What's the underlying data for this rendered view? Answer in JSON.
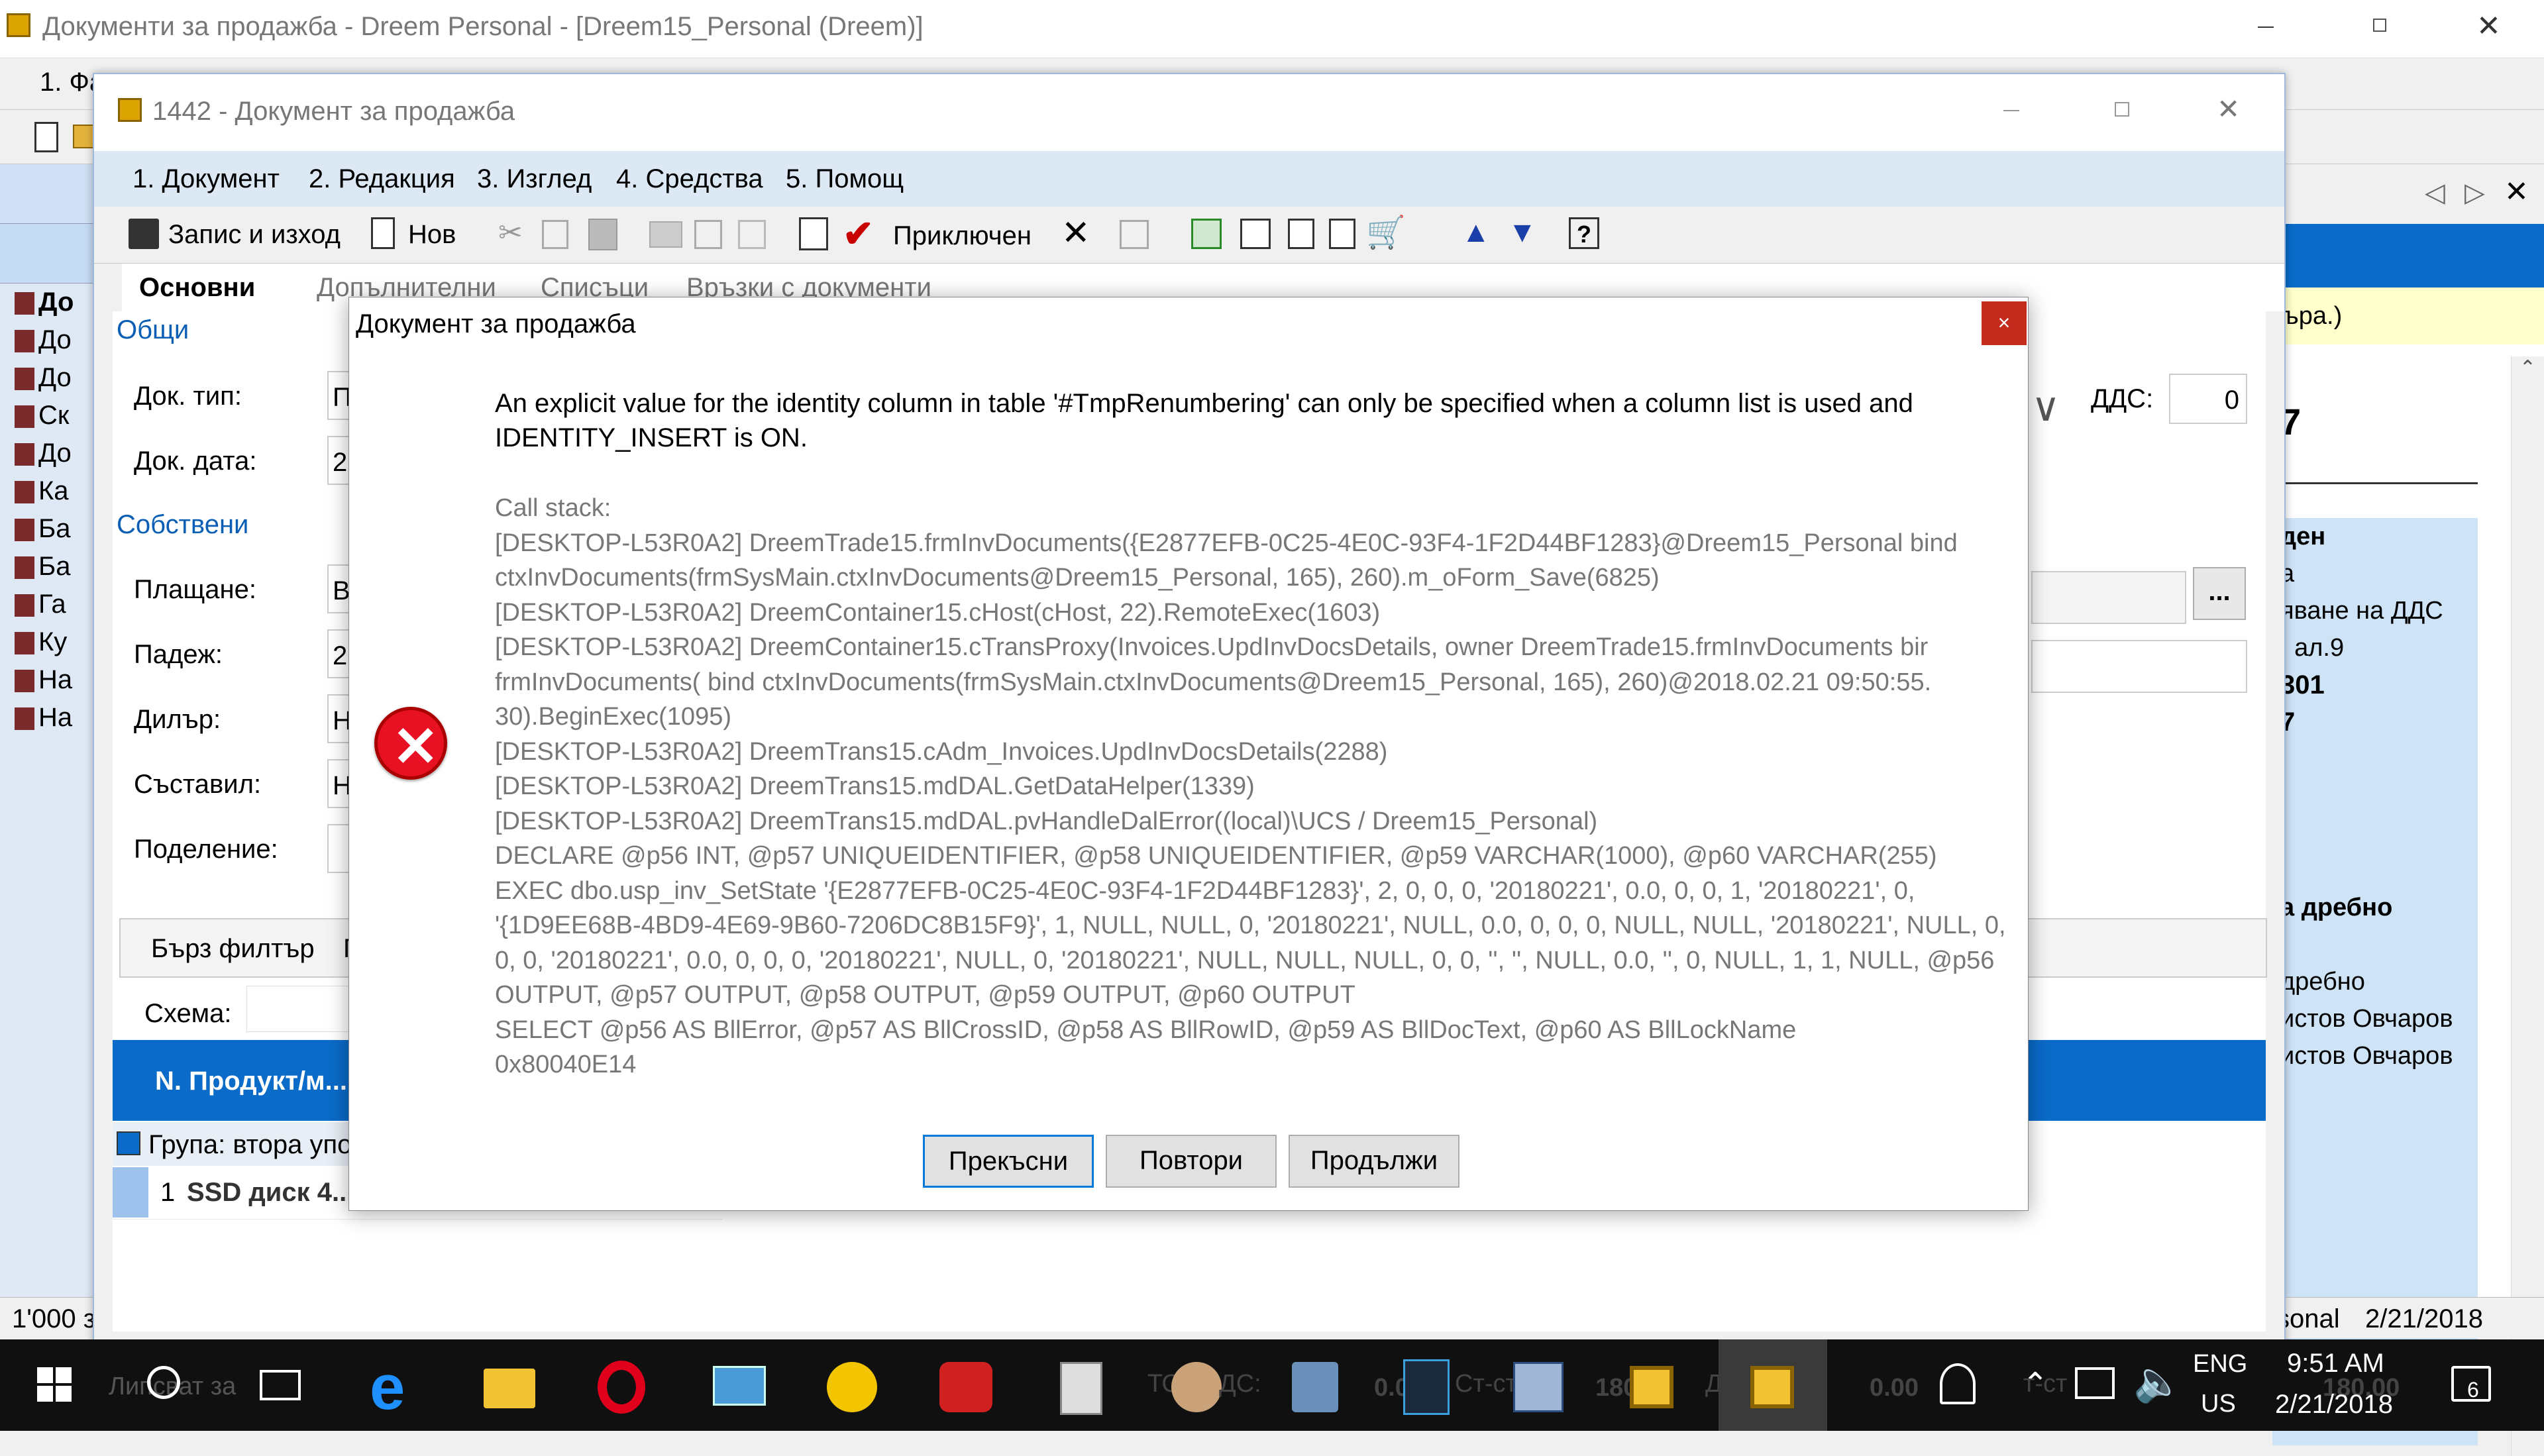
{
  "main_window": {
    "title": "Документи за продажба - Dreem Personal - [Dreem15_Personal (Dreem)]",
    "menu_partial": "1. Фа...",
    "left_list": [
      "До",
      "До",
      "До",
      "Ск",
      "До",
      "Ка",
      "Ба",
      "Ба",
      "Га",
      "Ку",
      "На",
      "На"
    ],
    "status_left": "1'000 з",
    "status_right_user": "sonal",
    "status_right_date": "2/21/2018",
    "right_panel": {
      "top_text": "ъра.)",
      "big_digit_1": "7",
      "rows": [
        "ден",
        "а",
        "яване на ДДС",
        ", ал.9",
        "301",
        "7"
      ],
      "lower_rows": [
        "а дребно",
        "дребно",
        "истов Овчаров",
        "истов Овчаров"
      ]
    }
  },
  "doc_window": {
    "title": "1442 - Документ за продажба",
    "menu": [
      "1. Документ",
      "2. Редакция",
      "3. Изглед",
      "4. Средства",
      "5. Помощ"
    ],
    "toolbar": {
      "save_exit": "Запис и изход",
      "new": "Нов",
      "closed": "Приключен"
    },
    "tabs": [
      "Основни",
      "Допълнителни",
      "Списъци",
      "Връзки с документи"
    ],
    "sections": {
      "general": "Общи",
      "own": "Собствени"
    },
    "fields": {
      "doc_type_label": "Док. тип:",
      "doc_date_label": "Док. дата:",
      "payment_label": "Плащане:",
      "due_label": "Падеж:",
      "dealer_label": "Дилър:",
      "author_label": "Съставил:",
      "division_label": "Поделение:",
      "doc_type_value": "П",
      "doc_date_value": "2",
      "payment_value": "В",
      "due_value": "2",
      "dealer_value": "Н",
      "author_value": "Н",
      "vat_label": "ДДС:",
      "vat_value": "0",
      "browse_button": "..."
    },
    "grid": {
      "quick_filter": "Бърз филтър",
      "quick_filter_2": "Г",
      "scheme_label": "Схема:",
      "col_header": "N. Продукт/м...",
      "group_row": "Група: втора упо",
      "row_num": "1",
      "row_product": "SSD диск 4..."
    }
  },
  "dialog": {
    "title": "Документ за продажба",
    "close": "×",
    "message_lines": [
      "An explicit value for the identity column in table '#TmpRenumbering' can only be specified when a column list is used and",
      "IDENTITY_INSERT is ON."
    ],
    "callstack_lines": [
      "Call stack:",
      "[DESKTOP-L53R0A2] DreemTrade15.frmInvDocuments({E2877EFB-0C25-4E0C-93F4-1F2D44BF1283}@Dreem15_Personal bind",
      "ctxInvDocuments(frmSysMain.ctxInvDocuments@Dreem15_Personal, 165), 260).m_oForm_Save(6825)",
      "[DESKTOP-L53R0A2] DreemContainer15.cHost(cHost, 22).RemoteExec(1603)",
      "[DESKTOP-L53R0A2] DreemContainer15.cTransProxy(Invoices.UpdInvDocsDetails, owner DreemTrade15.frmInvDocuments bir",
      "frmInvDocuments( bind ctxInvDocuments(frmSysMain.ctxInvDocuments@Dreem15_Personal, 165), 260)@2018.02.21 09:50:55.",
      "30).BeginExec(1095)",
      "[DESKTOP-L53R0A2] DreemTrans15.cAdm_Invoices.UpdInvDocsDetails(2288)",
      "[DESKTOP-L53R0A2] DreemTrans15.mdDAL.GetDataHelper(1339)",
      "[DESKTOP-L53R0A2] DreemTrans15.mdDAL.pvHandleDalError((local)\\UCS / Dreem15_Personal)",
      "DECLARE @p56 INT, @p57 UNIQUEIDENTIFIER, @p58 UNIQUEIDENTIFIER, @p59 VARCHAR(1000), @p60 VARCHAR(255)",
      "EXEC dbo.usp_inv_SetState '{E2877EFB-0C25-4E0C-93F4-1F2D44BF1283}', 2, 0, 0, 0, '20180221', 0.0, 0, 0, 1, '20180221', 0,",
      "'{1D9EE68B-4BD9-4E69-9B60-7206DC8B15F9}', 1, NULL, NULL, 0, '20180221', NULL, 0.0, 0, 0, 0, NULL, NULL, '20180221', NULL, 0,",
      "0, 0, '20180221', 0.0, 0, 0, 0, '20180221', NULL, 0, '20180221', NULL, NULL, NULL, 0, 0, '', '', NULL, 0.0, '', 0, NULL, 1, 1, NULL, @p56",
      "OUTPUT, @p57 OUTPUT, @p58 OUTPUT, @p59 OUTPUT, @p60 OUTPUT",
      "SELECT @p56 AS BllError, @p57 AS BllCrossID, @p58 AS BllRowID, @p59 AS BllDocText, @p60 AS BllLockName",
      "0x80040E14"
    ],
    "buttons": {
      "abort": "Прекъсни",
      "retry": "Повтори",
      "continue": "Продължи"
    }
  },
  "taskbar": {
    "search_text": "Липсват за",
    "bg_text_1": "ТО",
    "bg_text_2": "ДС:",
    "bg_text_3": "0.0",
    "bg_text_4": "Ст-ст",
    "bg_text_5": "180",
    "bg_text_6": "ДДС",
    "bg_text_7": "0.00",
    "bg_text_8": "т-ст",
    "bg_text_9": "180.00",
    "lang_top": "ENG",
    "lang_bottom": "US",
    "time": "9:51 AM",
    "date": "2/21/2018",
    "notifications": "6"
  },
  "colors": {
    "accent": "#0078d7",
    "selection_blue": "#0a6bc9",
    "error_red": "#e81123",
    "dialog_close": "#c42b1c"
  }
}
